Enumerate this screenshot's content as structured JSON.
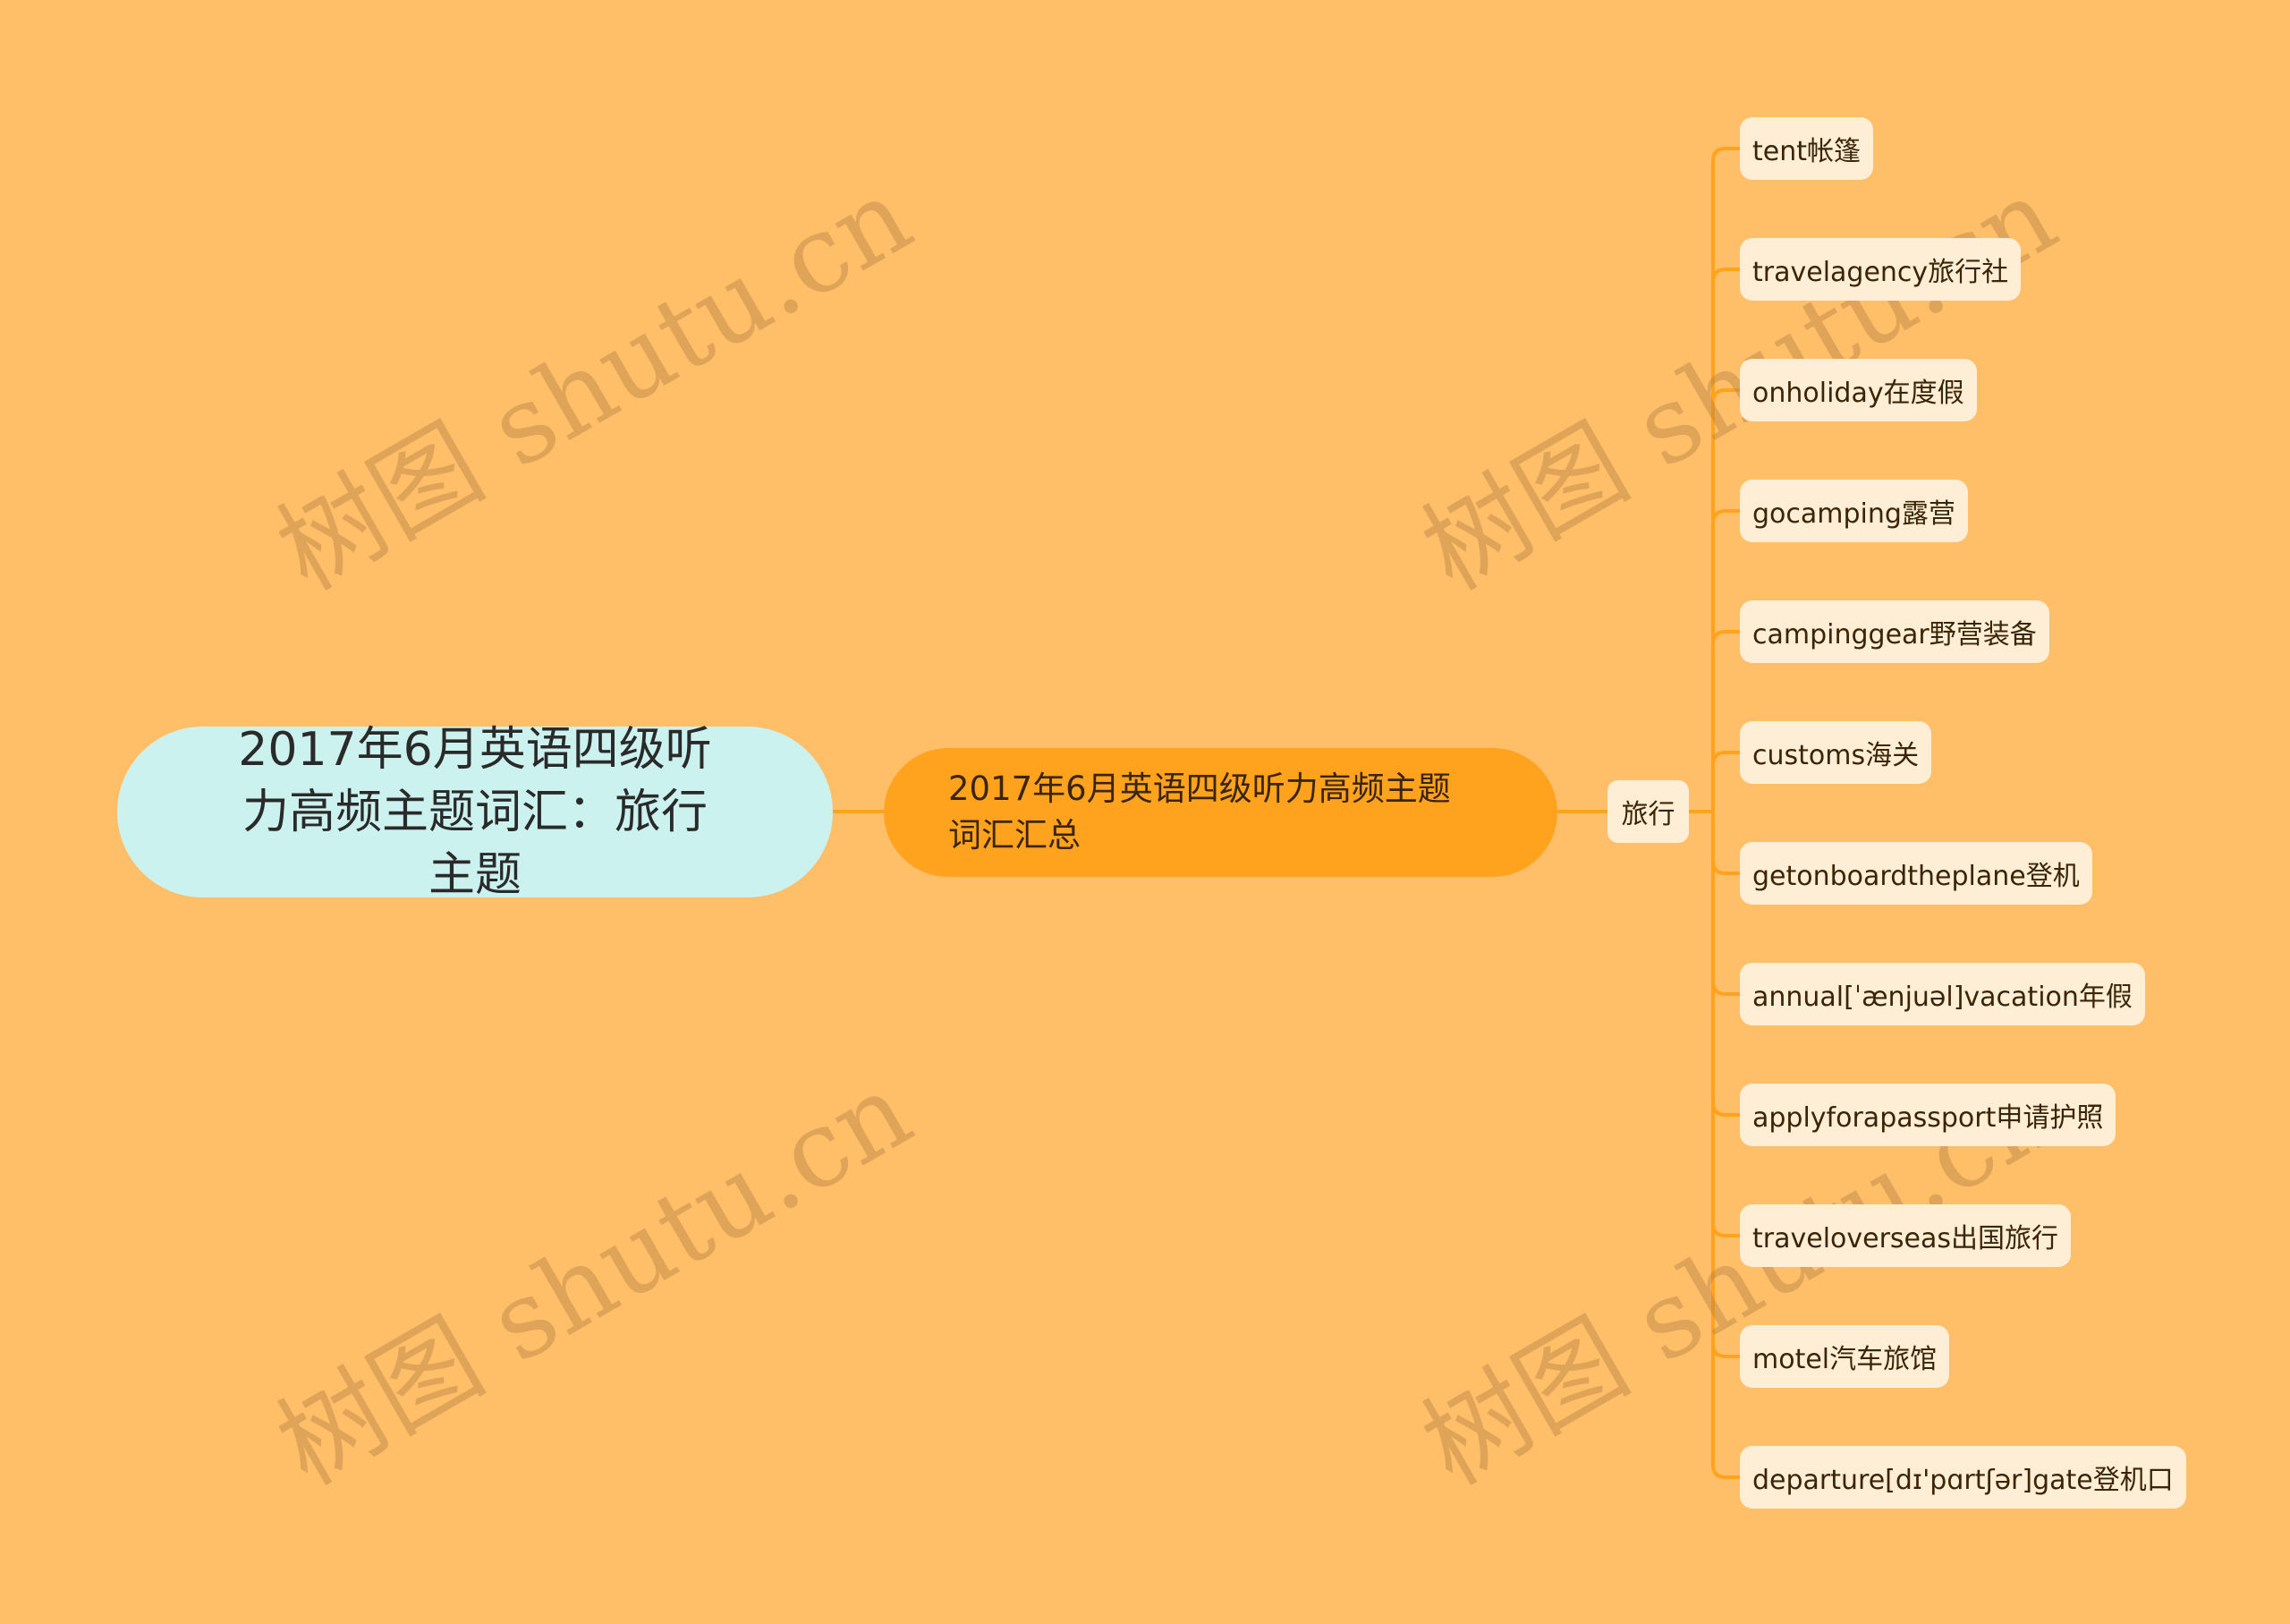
{
  "mindmap": {
    "root": {
      "label": "2017年6月英语四级听力高频主题词汇：旅行主题"
    },
    "main": {
      "label": "2017年6月英语四级听力高频主题词汇汇总"
    },
    "category": {
      "label": "旅行"
    },
    "leaves": [
      {
        "label": "tent帐篷"
      },
      {
        "label": "travelagency旅行社"
      },
      {
        "label": "onholiday在度假"
      },
      {
        "label": "gocamping露营"
      },
      {
        "label": "campinggear野营装备"
      },
      {
        "label": "customs海关"
      },
      {
        "label": "getonboardtheplane登机"
      },
      {
        "label": "annual[ˈænjuəl]vacation年假"
      },
      {
        "label": "applyforapassport申请护照"
      },
      {
        "label": "traveloverseas出国旅行"
      },
      {
        "label": "motel汽车旅馆"
      },
      {
        "label": "departure[dɪ'pɑrtʃər]gate登机口"
      }
    ]
  },
  "watermark": {
    "text": "树图 shutu.cn"
  },
  "colors": {
    "background": "#FFBF69",
    "root_fill": "#CCF2EF",
    "main_fill": "#FFA31F",
    "leaf_fill": "#FFEED6",
    "connector": "#FFA31F"
  }
}
